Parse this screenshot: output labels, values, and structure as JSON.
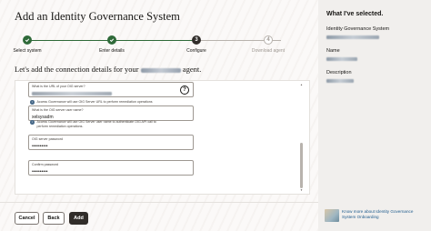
{
  "page": {
    "title": "Add an Identity Governance System"
  },
  "stepper": {
    "steps": [
      {
        "label": "Select system",
        "status": "done",
        "marker": ""
      },
      {
        "label": "Enter details",
        "status": "done",
        "marker": ""
      },
      {
        "label": "Configure",
        "status": "current",
        "marker": "3"
      },
      {
        "label": "Download agent",
        "status": "todo",
        "marker": "4"
      }
    ]
  },
  "form": {
    "heading_prefix": "Let's add the connection details for your",
    "heading_suffix": "agent.",
    "fields": {
      "oig_url": {
        "label": "What is the URL of your OIG server?",
        "help_icon": "?",
        "hint": "Access Governance will use OIG Server URL to perform remediation operations"
      },
      "oig_user": {
        "label": "What is the OIG server user name?",
        "value": "xelsysadm",
        "hint_line1": "Access Governance will use OIG Server user name to authenticate OIG API call to",
        "hint_line2": "perform remediation operations."
      },
      "oig_password": {
        "label": "OIG server password",
        "value": "••••••••••"
      },
      "confirm_password": {
        "label": "Confirm password",
        "value": "••••••••••"
      }
    },
    "info_icon_glyph": "i"
  },
  "footer": {
    "cancel_label": "Cancel",
    "back_label": "Back",
    "add_label": "Add"
  },
  "sidebar": {
    "title": "What I've selected.",
    "items": [
      {
        "label": "Identity Governance System"
      },
      {
        "label": "Name"
      },
      {
        "label": "Description"
      }
    ],
    "learn_more": "Know more about Identity Governance System Onboarding"
  },
  "icons": {
    "check": "check-icon",
    "help": "help-icon",
    "info": "info-icon"
  },
  "colors": {
    "step_done": "#2f6a39",
    "step_current": "#312d2a",
    "primary_button": "#312d2a",
    "link": "#1d5a8c"
  }
}
